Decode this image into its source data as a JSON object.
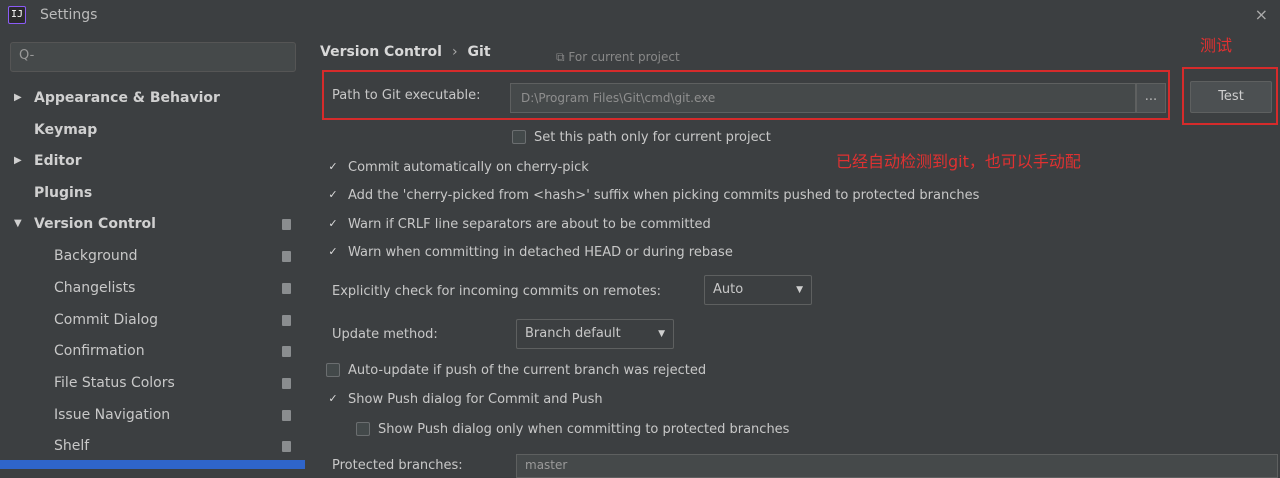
{
  "window": {
    "title": "Settings",
    "app_icon": "IJ",
    "close_glyph": "×"
  },
  "sidebar": {
    "search_placeholder": "Q-",
    "items": [
      {
        "label": "Appearance & Behavior",
        "expanded": false,
        "level": 0
      },
      {
        "label": "Keymap",
        "level": 0
      },
      {
        "label": "Editor",
        "expanded": false,
        "level": 0
      },
      {
        "label": "Plugins",
        "level": 0
      },
      {
        "label": "Version Control",
        "expanded": true,
        "level": 0
      },
      {
        "label": "Background",
        "level": 1
      },
      {
        "label": "Changelists",
        "level": 1
      },
      {
        "label": "Commit Dialog",
        "level": 1
      },
      {
        "label": "Confirmation",
        "level": 1
      },
      {
        "label": "File Status Colors",
        "level": 1
      },
      {
        "label": "Issue Navigation",
        "level": 1
      },
      {
        "label": "Shelf",
        "level": 1
      }
    ]
  },
  "main": {
    "breadcrumb": {
      "parent": "Version Control",
      "separator": "›",
      "current": "Git"
    },
    "for_current_project": "⧉ For current project",
    "path": {
      "label": "Path to Git executable:",
      "value": "D:\\Program Files\\Git\\cmd\\git.exe",
      "browse_label": "...",
      "test_label": "Test"
    },
    "set_path_only_label": "Set this path only for current project",
    "annotations": {
      "test_note": "测试",
      "autodetect_note": "已经自动检测到git，也可以手动配"
    },
    "checks": [
      {
        "label": "Commit automatically on cherry-pick",
        "checked": true
      },
      {
        "label": "Add the 'cherry-picked from <hash>' suffix when picking commits pushed to protected branches",
        "checked": true
      },
      {
        "label": "Warn if CRLF line separators are about to be committed",
        "checked": true
      },
      {
        "label": "Warn when committing in detached HEAD or during rebase",
        "checked": true
      }
    ],
    "incoming": {
      "label": "Explicitly check for incoming commits on remotes:",
      "value": "Auto"
    },
    "update_method": {
      "label": "Update method:",
      "value": "Branch default"
    },
    "checks2": [
      {
        "label": "Auto-update if push of the current branch was rejected",
        "checked": false
      },
      {
        "label": "Show Push dialog for Commit and Push",
        "checked": true
      }
    ],
    "protected_only": {
      "label": "Show Push dialog only when committing to protected branches",
      "checked": false
    },
    "protected_branches": {
      "label": "Protected branches:",
      "value": "master"
    }
  },
  "colors": {
    "annotation": "#e03131",
    "selection": "#2f65ca",
    "background": "#3c3f41"
  }
}
